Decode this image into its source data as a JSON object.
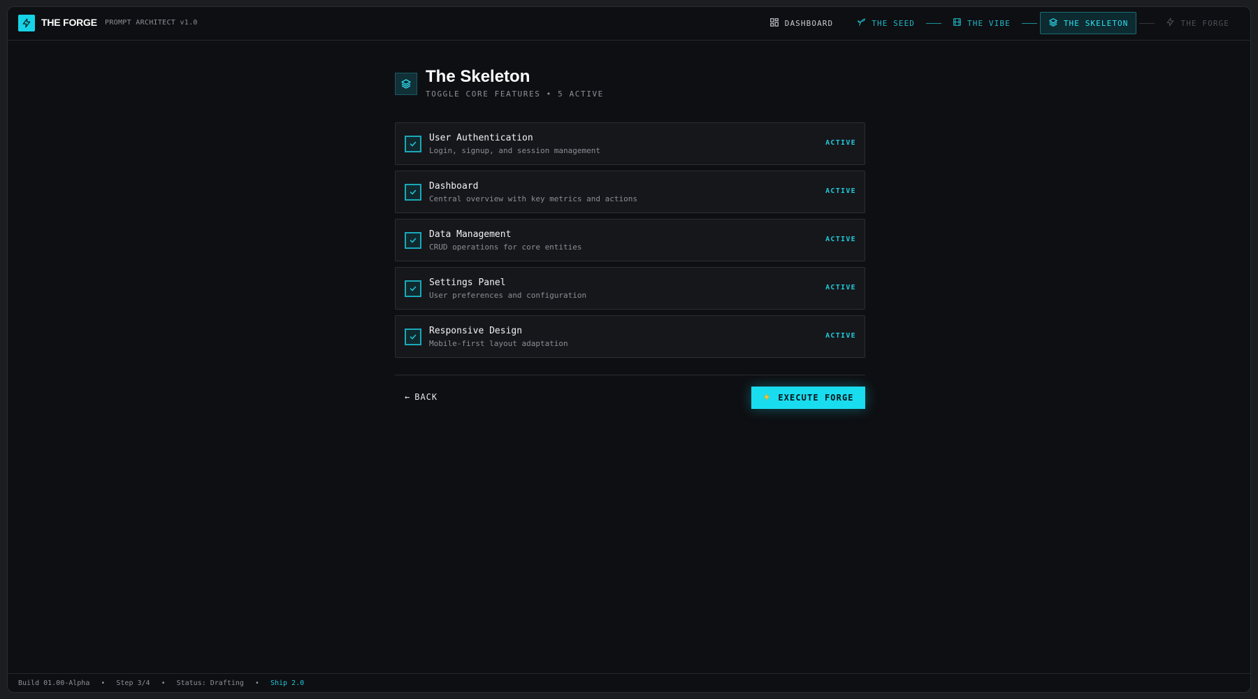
{
  "app": {
    "brand": "THE FORGE",
    "subtitle": "PROMPT ARCHITECT v1.0"
  },
  "nav": {
    "dashboard": "DASHBOARD",
    "steps": [
      {
        "label": "THE SEED",
        "state": "done"
      },
      {
        "label": "THE VIBE",
        "state": "done"
      },
      {
        "label": "THE SKELETON",
        "state": "current"
      },
      {
        "label": "THE FORGE",
        "state": "future"
      }
    ]
  },
  "page": {
    "title": "The Skeleton",
    "subtitle": "TOGGLE CORE FEATURES • 5 ACTIVE"
  },
  "features": [
    {
      "title": "User Authentication",
      "desc": "Login, signup, and session management",
      "status": "ACTIVE",
      "checked": true
    },
    {
      "title": "Dashboard",
      "desc": "Central overview with key metrics and actions",
      "status": "ACTIVE",
      "checked": true
    },
    {
      "title": "Data Management",
      "desc": "CRUD operations for core entities",
      "status": "ACTIVE",
      "checked": true
    },
    {
      "title": "Settings Panel",
      "desc": "User preferences and configuration",
      "status": "ACTIVE",
      "checked": true
    },
    {
      "title": "Responsive Design",
      "desc": "Mobile-first layout adaptation",
      "status": "ACTIVE",
      "checked": true
    }
  ],
  "actions": {
    "back": "BACK",
    "execute": "EXECUTE FORGE"
  },
  "footer": {
    "build": "Build 01.00-Alpha",
    "step": "Step 3/4",
    "status": "Status: Drafting",
    "ship": "Ship 2.0"
  },
  "colors": {
    "accent": "#19dcef",
    "background": "#0e0f12",
    "card": "#16171b"
  },
  "icons": {
    "logo": "bolt-icon",
    "dashboard": "grid-icon",
    "seed": "sprout-icon",
    "vibe": "film-icon",
    "skeleton": "layers-icon",
    "forge": "bolt-icon",
    "check": "check-icon",
    "back": "arrow-left-icon",
    "execute": "lightning-icon"
  }
}
